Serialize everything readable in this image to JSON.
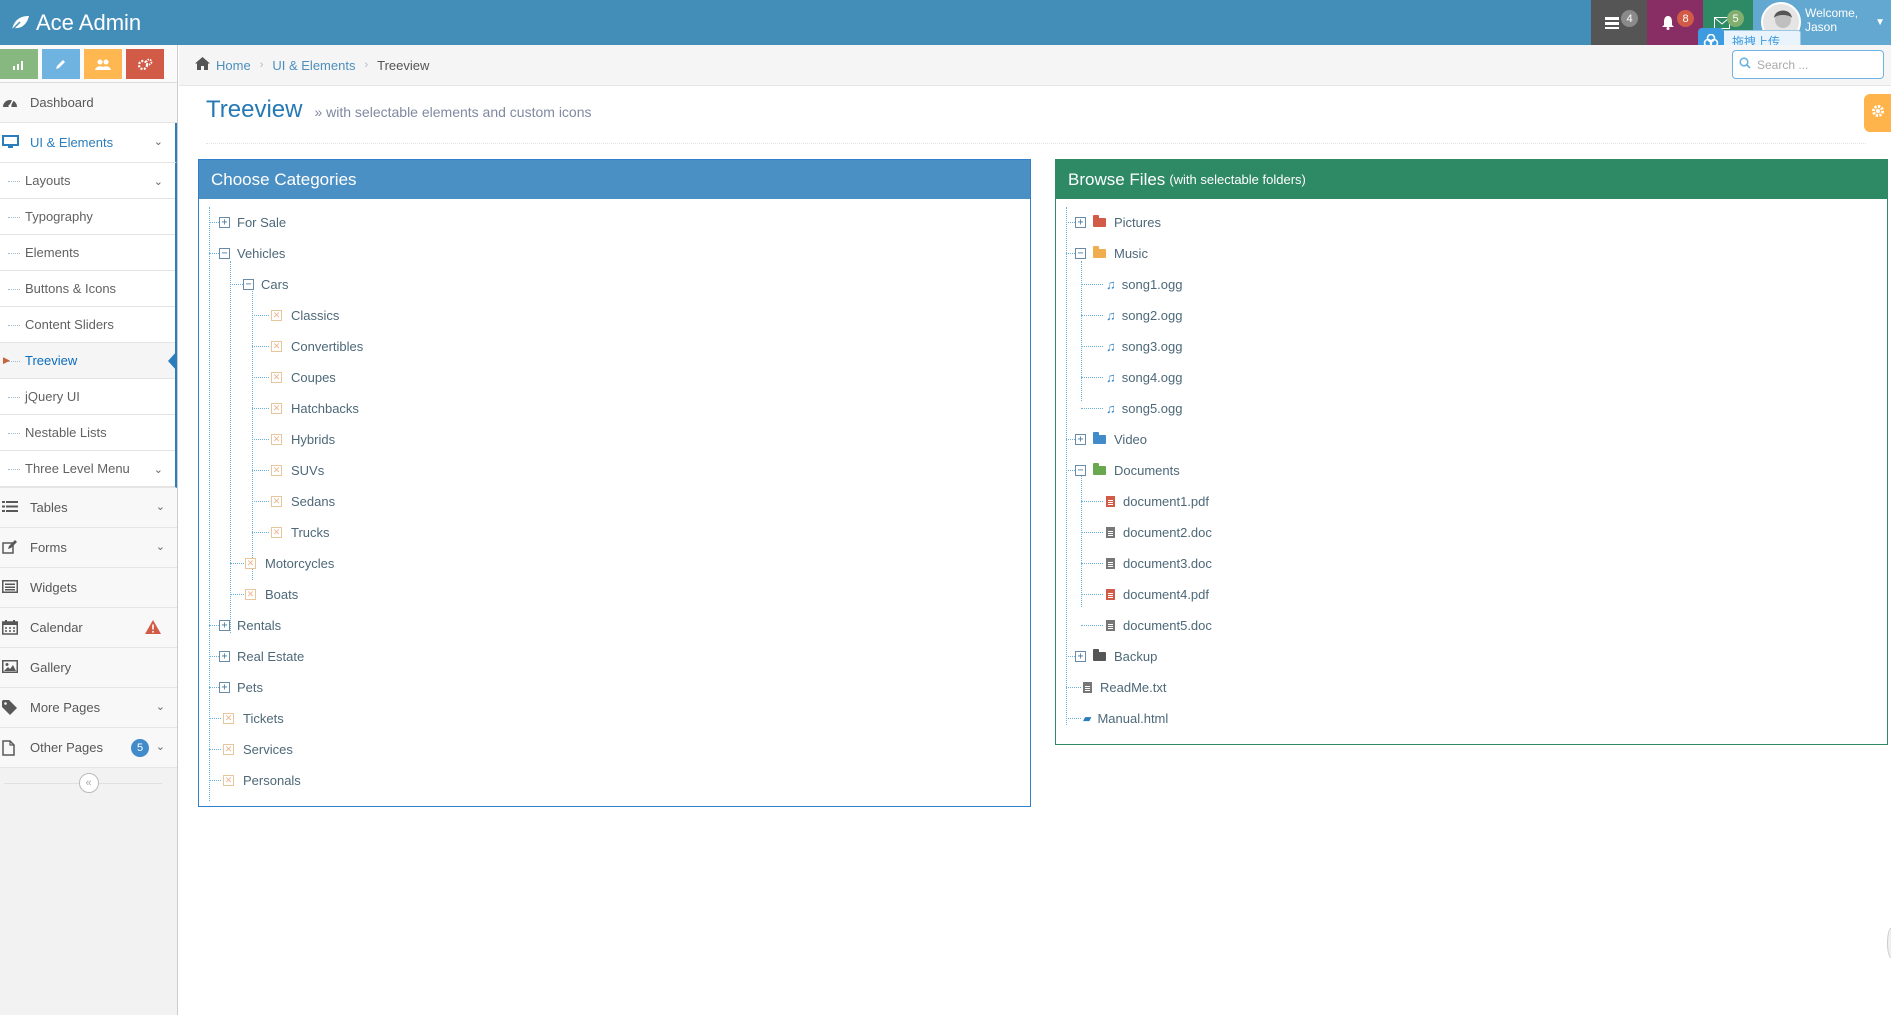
{
  "app": {
    "brand": "Ace Admin"
  },
  "navbar": {
    "tasks_count": "4",
    "notifications_count": "8",
    "messages_count": "5",
    "welcome": "Welcome,",
    "user_name": "Jason",
    "upload_label": "拖拽上传"
  },
  "shortcuts": [
    {
      "icon": "signal-icon",
      "color": "#87b87f"
    },
    {
      "icon": "pencil-icon",
      "color": "#6fb3e0"
    },
    {
      "icon": "users-icon",
      "color": "#ffb752"
    },
    {
      "icon": "cogs-icon",
      "color": "#d15b47"
    }
  ],
  "sidebar": {
    "items": [
      {
        "label": "Dashboard",
        "icon": "tachometer-icon"
      },
      {
        "label": "UI & Elements",
        "icon": "desktop-icon"
      },
      {
        "label": "Tables",
        "icon": "list-icon"
      },
      {
        "label": "Forms",
        "icon": "pencil-square-icon"
      },
      {
        "label": "Widgets",
        "icon": "list-alt-icon"
      },
      {
        "label": "Calendar",
        "icon": "calendar-icon"
      },
      {
        "label": "Gallery",
        "icon": "picture-icon"
      },
      {
        "label": "More Pages",
        "icon": "tag-icon"
      },
      {
        "label": "Other Pages",
        "icon": "file-icon",
        "badge": "5"
      }
    ],
    "submenu": [
      "Layouts",
      "Typography",
      "Elements",
      "Buttons & Icons",
      "Content Sliders",
      "Treeview",
      "jQuery UI",
      "Nestable Lists",
      "Three Level Menu"
    ],
    "active_submenu": "Treeview"
  },
  "breadcrumb": {
    "home": "Home",
    "section": "UI & Elements",
    "current": "Treeview"
  },
  "search": {
    "placeholder": "Search ..."
  },
  "page": {
    "title": "Treeview",
    "subtitle": "» with selectable elements and custom icons"
  },
  "categories_widget": {
    "title": "Choose Categories",
    "tree": {
      "for_sale": "For Sale",
      "vehicles": "Vehicles",
      "cars": "Cars",
      "car_types": [
        "Classics",
        "Convertibles",
        "Coupes",
        "Hatchbacks",
        "Hybrids",
        "SUVs",
        "Sedans",
        "Trucks"
      ],
      "motorcycles": "Motorcycles",
      "boats": "Boats",
      "rentals": "Rentals",
      "real_estate": "Real Estate",
      "pets": "Pets",
      "tickets": "Tickets",
      "services": "Services",
      "personals": "Personals"
    }
  },
  "files_widget": {
    "title": "Browse Files",
    "title_note": "(with selectable folders)",
    "tree": {
      "pictures": "Pictures",
      "music": "Music",
      "songs": [
        "song1.ogg",
        "song2.ogg",
        "song3.ogg",
        "song4.ogg",
        "song5.ogg"
      ],
      "video": "Video",
      "documents": "Documents",
      "docs": [
        "document1.pdf",
        "document2.doc",
        "document3.doc",
        "document4.pdf",
        "document5.doc"
      ],
      "backup": "Backup",
      "readme": "ReadMe.txt",
      "manual": "Manual.html"
    }
  },
  "colors": {
    "navbar": "#438eb9",
    "categories_header": "#4a90c5",
    "files_header": "#2e8965",
    "pictures_folder": "#d15b47",
    "music_folder": "#f0ad4e",
    "video_folder": "#428bca",
    "documents_folder": "#6aa84f",
    "backup_folder": "#555555"
  }
}
